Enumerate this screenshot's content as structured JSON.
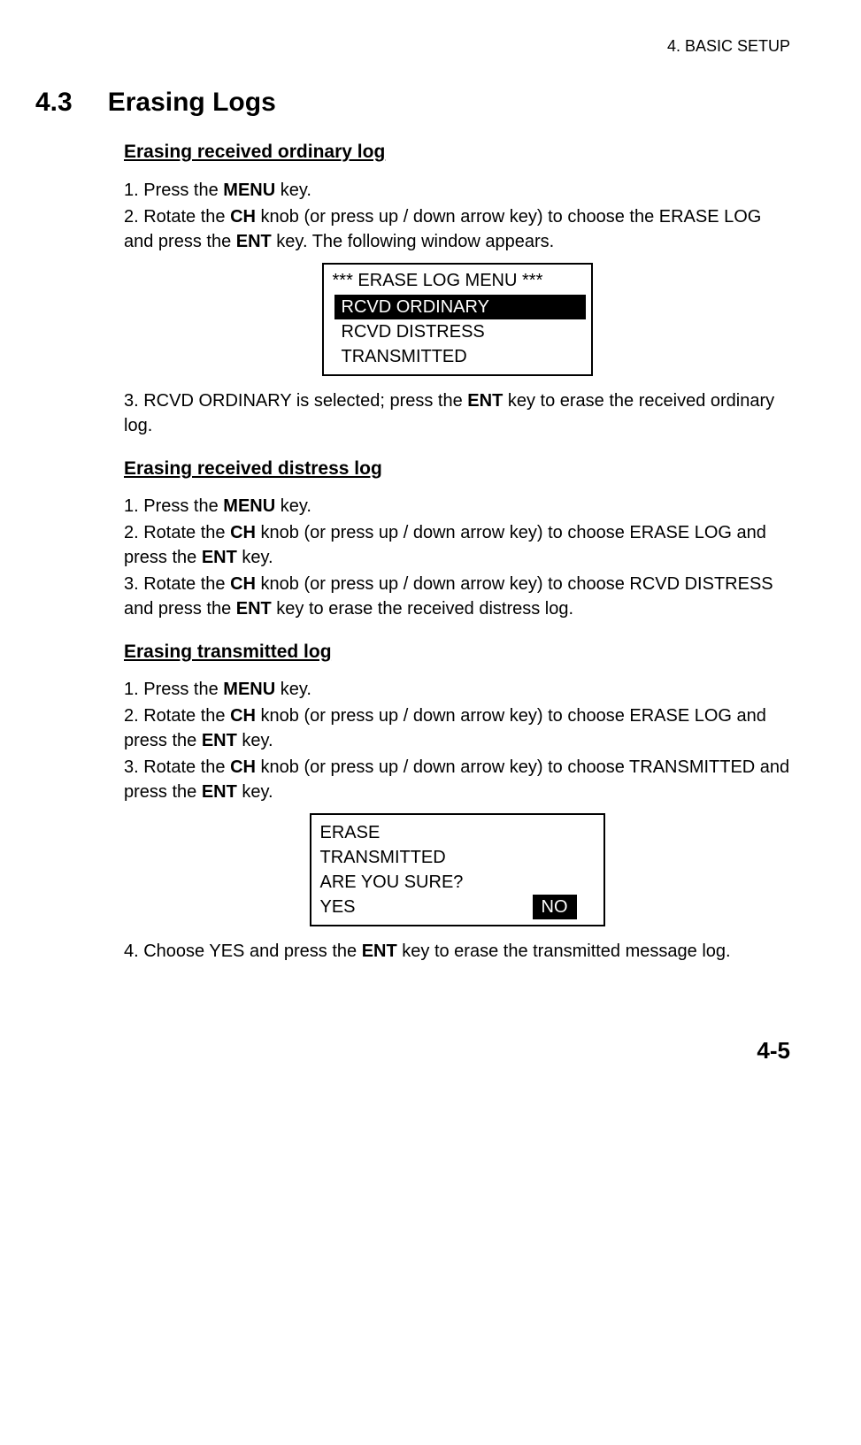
{
  "header": {
    "chapter": "4.  BASIC  SETUP"
  },
  "section": {
    "number": "4.3",
    "title": "Erasing Logs"
  },
  "sub1": {
    "title": "Erasing received ordinary log",
    "step1_pre": "1. Press the ",
    "step1_bold": "MENU",
    "step1_post": " key.",
    "step2_pre": "2. Rotate the ",
    "step2_b1": "CH",
    "step2_mid": " knob (or press up / down arrow key) to choose the ERASE LOG and press the ",
    "step2_b2": "ENT",
    "step2_post": " key. The following window appears.",
    "menu": {
      "title": "*** ERASE LOG MENU ***",
      "item1": "RCVD ORDINARY",
      "item2": "RCVD DISTRESS",
      "item3": "TRANSMITTED"
    },
    "step3_pre": "3. RCVD ORDINARY is selected; press the ",
    "step3_bold": "ENT",
    "step3_post": " key to erase the received ordinary log."
  },
  "sub2": {
    "title": "Erasing received distress log",
    "step1_pre": "1. Press the ",
    "step1_bold": "MENU",
    "step1_post": " key.",
    "step2_pre": "2. Rotate the ",
    "step2_b1": "CH",
    "step2_mid": " knob (or press up / down arrow key) to choose ERASE LOG and press the ",
    "step2_b2": "ENT",
    "step2_post": " key.",
    "step3_pre": "3. Rotate the ",
    "step3_b1": "CH",
    "step3_mid": " knob (or press up / down arrow key) to choose RCVD DISTRESS and press the ",
    "step3_b2": "ENT",
    "step3_post": " key to erase the received distress log."
  },
  "sub3": {
    "title": "Erasing transmitted log",
    "step1_pre": "1. Press the ",
    "step1_bold": "MENU",
    "step1_post": " key.",
    "step2_pre": "2. Rotate the ",
    "step2_b1": "CH",
    "step2_mid": " knob (or press up / down arrow key) to choose ERASE LOG and press the ",
    "step2_b2": "ENT",
    "step2_post": " key.",
    "step3_pre": "3. Rotate the ",
    "step3_b1": "CH",
    "step3_mid": " knob (or press up / down arrow key) to choose TRANSMITTED and press the ",
    "step3_b2": "ENT",
    "step3_post": " key.",
    "confirm": {
      "line1": "ERASE",
      "line2": "TRANSMITTED",
      "line3": "ARE YOU SURE?",
      "yes": "YES",
      "no": "NO"
    },
    "step4_pre": "4. Choose YES and press the ",
    "step4_bold": "ENT",
    "step4_post": " key to erase the transmitted message log."
  },
  "footer": {
    "page": "4-5"
  }
}
